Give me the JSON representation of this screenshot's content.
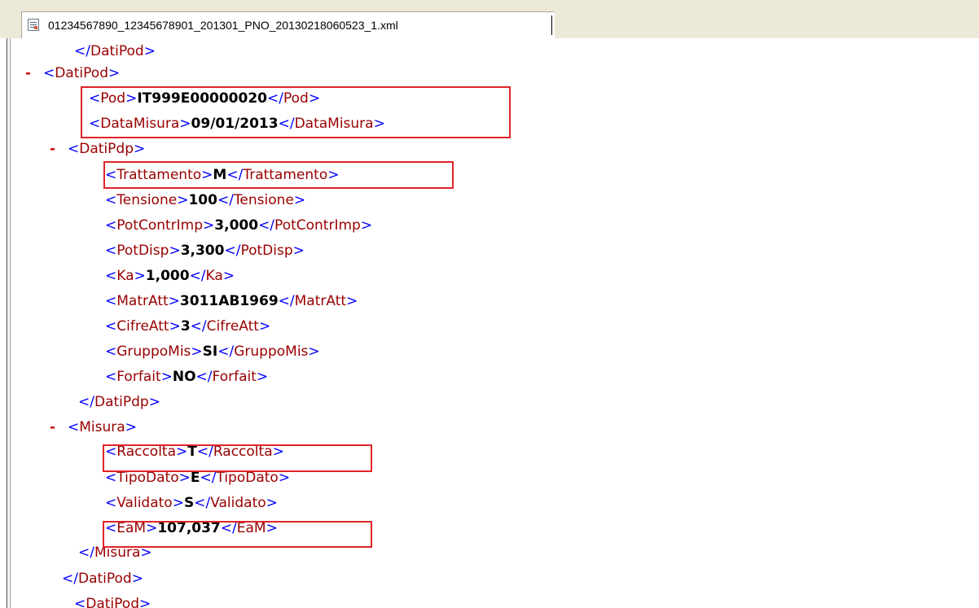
{
  "tab": {
    "filename": "01234567890_12345678901_201301_PNO_20130218060523_1.xml",
    "icon": "xml-file-icon"
  },
  "xml": {
    "lines": [
      {
        "kind": "close",
        "tag": "DatiPod"
      },
      {
        "kind": "open",
        "tag": "DatiPod",
        "collapse": "-"
      },
      {
        "kind": "leaf",
        "tag": "Pod",
        "value": "IT999E00000020"
      },
      {
        "kind": "leaf",
        "tag": "DataMisura",
        "value": "09/01/2013"
      },
      {
        "kind": "open",
        "tag": "DatiPdp",
        "collapse": "-"
      },
      {
        "kind": "leaf",
        "tag": "Trattamento",
        "value": "M"
      },
      {
        "kind": "leaf",
        "tag": "Tensione",
        "value": "100"
      },
      {
        "kind": "leaf",
        "tag": "PotContrImp",
        "value": "3,000"
      },
      {
        "kind": "leaf",
        "tag": "PotDisp",
        "value": "3,300"
      },
      {
        "kind": "leaf",
        "tag": "Ka",
        "value": "1,000"
      },
      {
        "kind": "leaf",
        "tag": "MatrAtt",
        "value": "3011AB1969"
      },
      {
        "kind": "leaf",
        "tag": "CifreAtt",
        "value": "3"
      },
      {
        "kind": "leaf",
        "tag": "GruppoMis",
        "value": "SI"
      },
      {
        "kind": "leaf",
        "tag": "Forfait",
        "value": "NO"
      },
      {
        "kind": "close",
        "tag": "DatiPdp"
      },
      {
        "kind": "open",
        "tag": "Misura",
        "collapse": "-"
      },
      {
        "kind": "leaf",
        "tag": "Raccolta",
        "value": "T"
      },
      {
        "kind": "leaf",
        "tag": "TipoDato",
        "value": "E"
      },
      {
        "kind": "leaf",
        "tag": "Validato",
        "value": "S"
      },
      {
        "kind": "leaf",
        "tag": "EaM",
        "value": "107,037"
      },
      {
        "kind": "close",
        "tag": "Misura"
      },
      {
        "kind": "close",
        "tag": "DatiPod"
      },
      {
        "kind": "open",
        "tag": "DatiPod"
      }
    ]
  },
  "highlight_color": "#e0242a"
}
